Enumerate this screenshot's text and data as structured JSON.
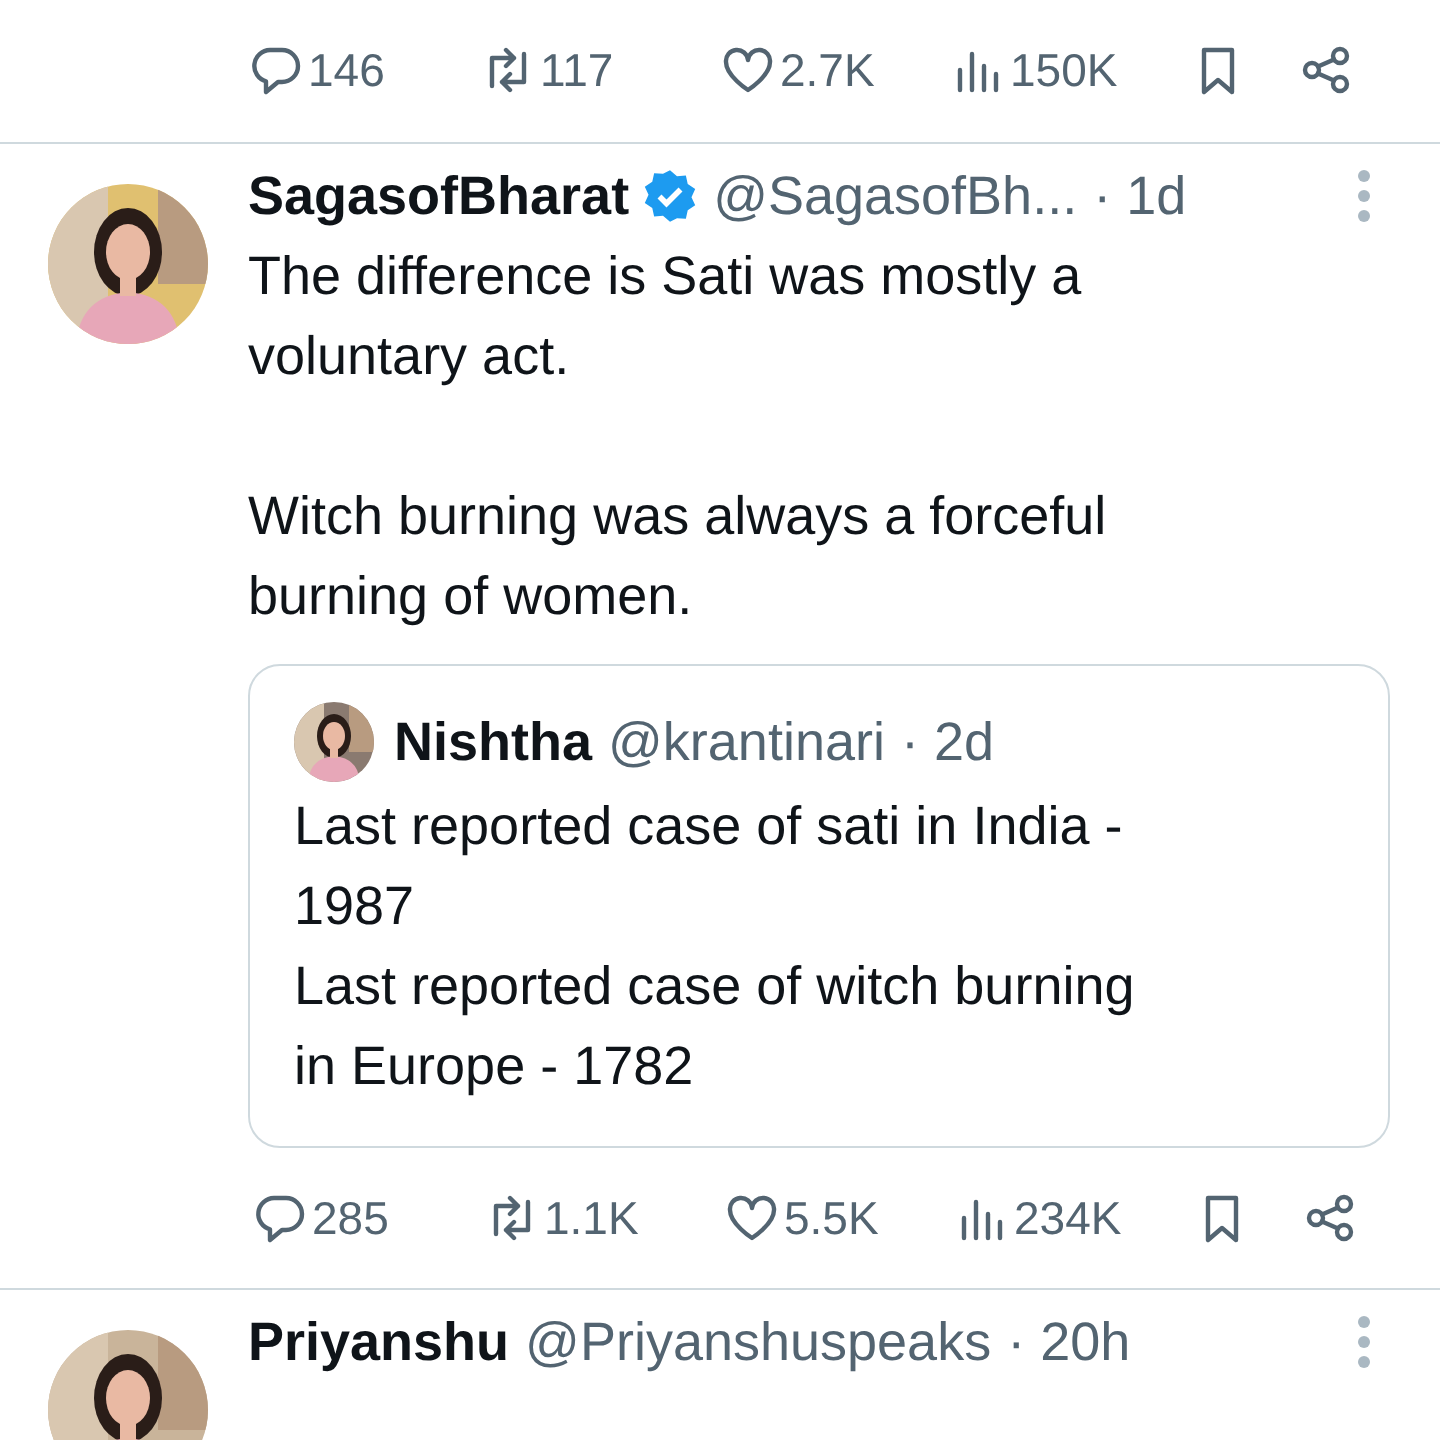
{
  "tweets": [
    {
      "actions": {
        "replies": "146",
        "reposts": "117",
        "likes": "2.7K",
        "views": "150K"
      }
    },
    {
      "author": {
        "name": "SagasofBharat",
        "verified": true,
        "handle": "@SagasofBh...",
        "time": "· 1d"
      },
      "text": "The difference is Sati was mostly a voluntary act.\n\nWitch burning was always a forceful burning of women.",
      "quote": {
        "author": {
          "name": "Nishtha",
          "verified": false,
          "handle": "@krantinari",
          "time": "· 2d"
        },
        "text": "Last reported case of sati in India - 1987\nLast reported case of witch burning in Europe - 1782"
      },
      "actions": {
        "replies": "285",
        "reposts": "1.1K",
        "likes": "5.5K",
        "views": "234K"
      }
    },
    {
      "author": {
        "name": "Priyanshu",
        "verified": false,
        "handle": "@Priyanshuspeaks",
        "time": "· 20h"
      }
    }
  ]
}
